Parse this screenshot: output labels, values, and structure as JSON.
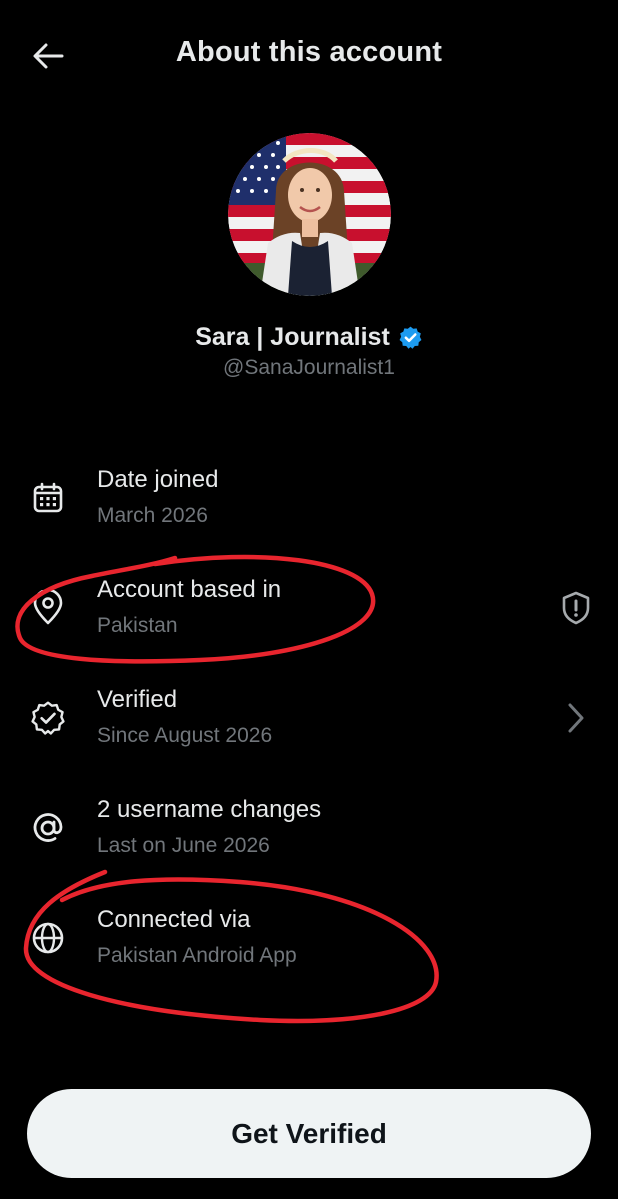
{
  "header": {
    "title": "About this account",
    "back_icon": "arrow-left-icon"
  },
  "profile": {
    "display_name": "Sara | Journalist",
    "handle": "@SanaJournalist1",
    "verified_badge_color": "#1d9bf0",
    "avatar": "profile-photo"
  },
  "details": [
    {
      "icon": "calendar-icon",
      "title": "Date joined",
      "subtitle": "March 2026"
    },
    {
      "icon": "location-pin-icon",
      "title": "Account based in",
      "subtitle": "Pakistan",
      "trailing_icon": "shield-alert-icon"
    },
    {
      "icon": "verified-badge-icon",
      "title": "Verified",
      "subtitle": "Since August 2026",
      "trailing_icon": "chevron-right-icon"
    },
    {
      "icon": "at-sign-icon",
      "title": "2 username changes",
      "subtitle": "Last on June 2026"
    },
    {
      "icon": "globe-icon",
      "title": "Connected via",
      "subtitle": "Pakistan Android App"
    }
  ],
  "annotations": {
    "circle_color": "#e8252e"
  },
  "cta": {
    "label": "Get Verified"
  },
  "colors": {
    "background": "#000000",
    "primary_text": "#e7e9ea",
    "secondary_text": "#71767b",
    "button_bg": "#eff3f4"
  }
}
